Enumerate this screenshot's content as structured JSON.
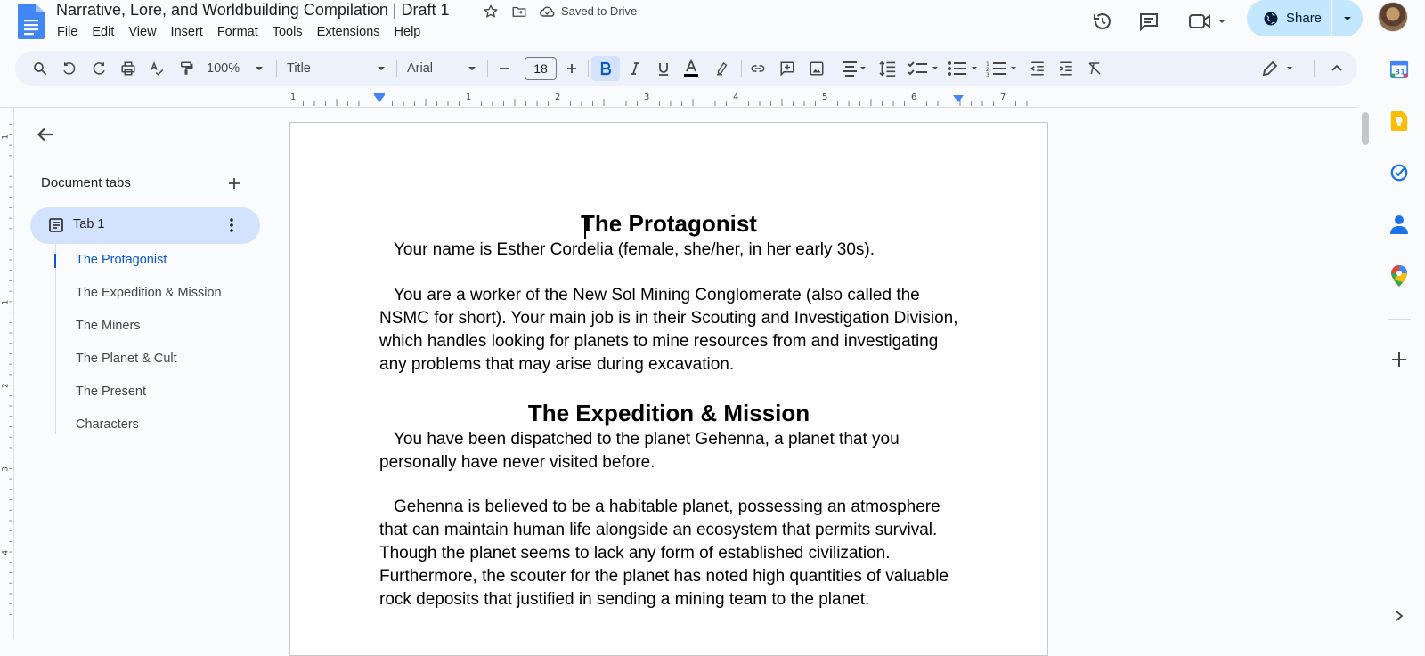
{
  "document": {
    "title": "Narrative, Lore, and Worldbuilding Compilation | Draft 1",
    "saved_status": "Saved to Drive"
  },
  "menu": [
    "File",
    "Edit",
    "View",
    "Insert",
    "Format",
    "Tools",
    "Extensions",
    "Help"
  ],
  "header": {
    "share_label": "Share"
  },
  "toolbar": {
    "zoom": "100%",
    "style": "Title",
    "font": "Arial",
    "font_size": "18"
  },
  "ruler": {
    "labels": [
      "1",
      "1",
      "2",
      "3",
      "4",
      "5",
      "6",
      "7"
    ],
    "vertical_labels": [
      "1",
      "1",
      "2",
      "3",
      "4"
    ]
  },
  "sidebar": {
    "section_label": "Document tabs",
    "tab": "Tab 1",
    "outline": [
      "The Protagonist",
      "The Expedition & Mission",
      "The Miners",
      "The Planet & Cult",
      "The Present",
      "Characters"
    ],
    "active_outline_index": 0
  },
  "content": {
    "heading1": "The Protagonist",
    "para1": "Your name is Esther Cordelia (female, she/her, in her early 30s).",
    "para2": "You are a worker of the New Sol Mining Conglomerate (also called the NSMC for short). Your main job is in their Scouting and Investigation Division, which handles looking for planets to mine resources from and investigating any problems that may arise during excavation.",
    "heading2": "The Expedition & Mission",
    "para3": "You have been dispatched to the planet Gehenna, a planet that you personally have never visited before.",
    "para4": "Gehenna is believed to be a habitable planet, possessing an atmosphere that can maintain human life alongside an ecosystem that permits survival. Though the planet seems to lack any form of established civilization. Furthermore, the scouter for the planet has noted high quantities of valuable rock deposits that justified in sending a mining team to the planet."
  },
  "icons": {
    "docs_logo": "docs-logo-icon",
    "calendar": "calendar-icon",
    "keep": "keep-icon",
    "tasks": "tasks-icon",
    "contacts": "contacts-icon",
    "maps": "maps-icon"
  },
  "colors": {
    "accent": "#0b57d0",
    "share_bg": "#c2e7ff",
    "toolbar_bg": "#edf2fa",
    "selected_tab": "#d3e3fd"
  }
}
